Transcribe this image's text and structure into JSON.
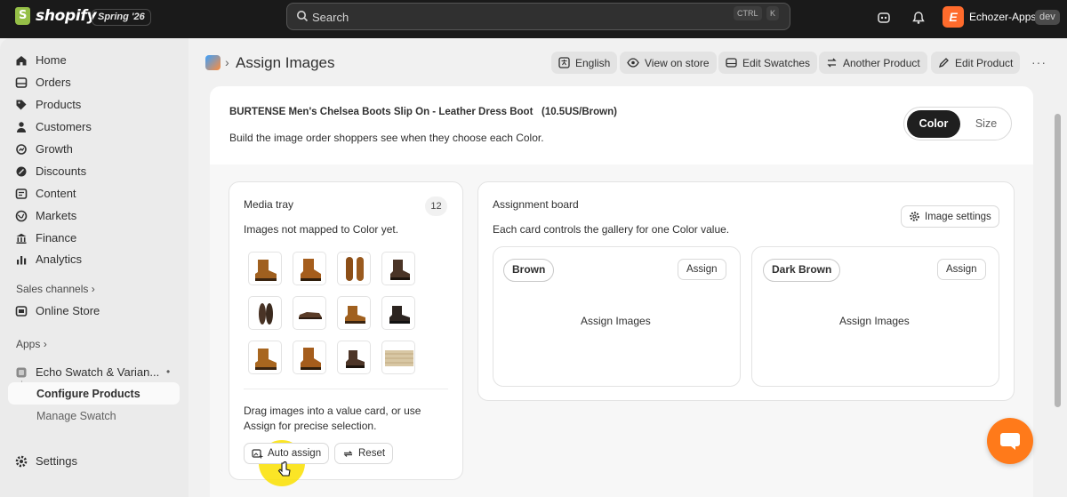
{
  "topbar": {
    "brand": "shopify",
    "edition": "Spring '26",
    "search_placeholder": "Search",
    "shortcut_key1": "CTRL",
    "shortcut_key2": "K",
    "store_initial": "E",
    "store_name": "Echozer-Apps",
    "env_badge": "dev"
  },
  "sidebar": {
    "items": [
      {
        "label": "Home",
        "icon": "home-icon"
      },
      {
        "label": "Orders",
        "icon": "orders-icon"
      },
      {
        "label": "Products",
        "icon": "tag-icon"
      },
      {
        "label": "Customers",
        "icon": "person-icon"
      },
      {
        "label": "Growth",
        "icon": "growth-icon"
      },
      {
        "label": "Discounts",
        "icon": "discount-icon"
      },
      {
        "label": "Content",
        "icon": "content-icon"
      },
      {
        "label": "Markets",
        "icon": "globe-icon"
      },
      {
        "label": "Finance",
        "icon": "bank-icon"
      },
      {
        "label": "Analytics",
        "icon": "bar-chart-icon"
      }
    ],
    "sales_channels_heading": "Sales channels",
    "online_store": "Online Store",
    "apps_heading": "Apps",
    "app_name": "Echo Swatch & Varian...",
    "app_sub_active": "Configure Products",
    "app_sub_other": "Manage Swatch",
    "settings": "Settings"
  },
  "header": {
    "title": "Assign Images",
    "actions": [
      "English",
      "View on store",
      "Edit Swatches",
      "Another Product",
      "Edit Product"
    ],
    "more": "···"
  },
  "product": {
    "title": "BURTENSE Men's Chelsea Boots Slip On - Leather Dress Boot   (10.5US/Brown)",
    "description": "Build the image order shoppers see when they choose each Color.",
    "option_tabs": [
      "Color",
      "Size"
    ],
    "selected_option": "Color"
  },
  "tray": {
    "title": "Media tray",
    "count": "12",
    "subtitle": "Images not mapped to Color yet.",
    "help": "Drag images into a value card, or use Assign for precise selection.",
    "auto_assign": "Auto assign",
    "reset": "Reset"
  },
  "board": {
    "title": "Assignment board",
    "subtitle": "Each card controls the gallery for one Color value.",
    "image_settings": "Image settings",
    "values": [
      {
        "name": "Brown",
        "assign": "Assign",
        "empty": "Assign Images"
      },
      {
        "name": "Dark Brown",
        "assign": "Assign",
        "empty": "Assign Images"
      }
    ]
  },
  "colors": {
    "topbar": "#1a1a1a",
    "accent_chat": "#ff7a1a",
    "cursor_highlight": "#fae100"
  }
}
